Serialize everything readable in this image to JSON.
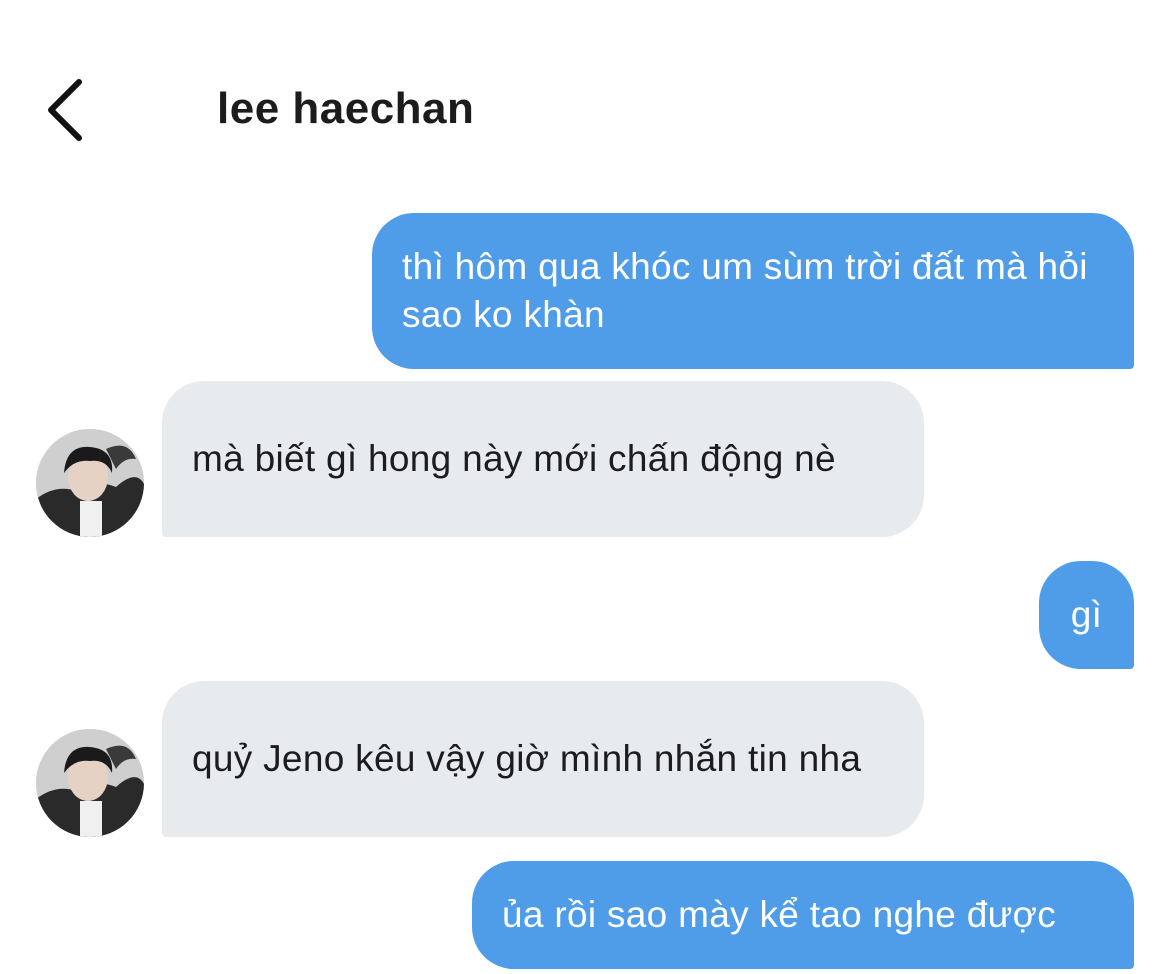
{
  "header": {
    "title": "lee haechan",
    "back_icon": "chevron-left-icon"
  },
  "messages": [
    {
      "side": "outgoing",
      "text": "thì hôm qua khóc um sùm trời đất mà hỏi sao ko khàn"
    },
    {
      "side": "incoming",
      "text": "mà biết gì hong này mới chấn động nè",
      "avatar": "contact-avatar"
    },
    {
      "side": "outgoing",
      "text": "gì"
    },
    {
      "side": "incoming",
      "text": "quỷ Jeno kêu vậy giờ mình nhắn tin nha",
      "avatar": "contact-avatar"
    },
    {
      "side": "outgoing",
      "text": "ủa rồi sao mày kể tao nghe được"
    }
  ],
  "colors": {
    "outgoing_bubble": "#4f9de8",
    "incoming_bubble": "#e8ebee",
    "text_dark": "#1c1c1e"
  }
}
